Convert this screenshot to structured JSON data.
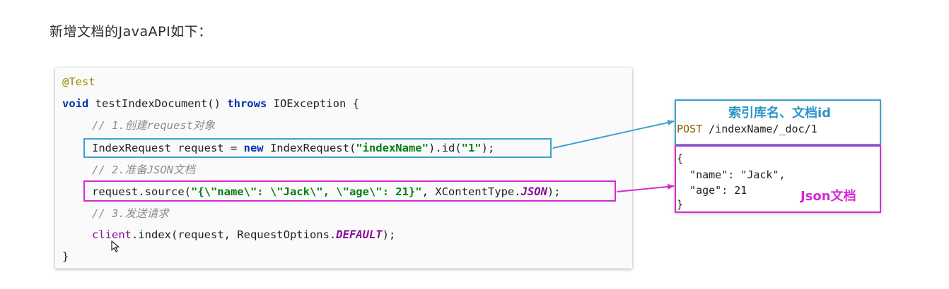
{
  "page": {
    "title": "新增文档的JavaAPI如下："
  },
  "code": {
    "line1": {
      "annotation": "@Test"
    },
    "line2": {
      "kw_void": "void",
      "method_sig": " testIndexDocument() ",
      "kw_throws": "throws",
      "rest": " IOException {"
    },
    "line3": {
      "comment": "// 1.创建request对象"
    },
    "line4": {
      "p1": "IndexRequest request = ",
      "kw_new": "new",
      "p2": " IndexRequest(",
      "str1": "\"indexName\"",
      "p3": ").id(",
      "str2": "\"1\"",
      "p4": ");"
    },
    "line5": {
      "comment": "// 2.准备JSON文档"
    },
    "line6": {
      "p1": "request.source(",
      "str": "\"{\\\"name\\\": \\\"Jack\\\", \\\"age\\\": 21}\"",
      "p2": ", XContentType.",
      "const": "JSON",
      "p3": ");"
    },
    "line7": {
      "comment": "// 3.发送请求"
    },
    "line8": {
      "field": "client",
      "p1": ".index(request, RequestOptions.",
      "const": "DEFAULT",
      "p2": ");"
    },
    "line9": {
      "brace": "}"
    }
  },
  "request_panel": {
    "title": "索引库名、文档id",
    "method": "POST",
    "path": " /indexName/_doc/1"
  },
  "json_panel": {
    "open_brace": "{",
    "line_name": "  \"name\": \"Jack\",",
    "line_age": "  \"age\": 21",
    "close_brace": "}",
    "label": "Json文档"
  },
  "colors": {
    "blue_highlight": "#3ea2cf",
    "pink_highlight": "#d62ad1",
    "keyword": "#0033b3",
    "string": "#067d17",
    "comment": "#8c8c8c",
    "annotation": "#9e880d",
    "constant": "#871094"
  }
}
